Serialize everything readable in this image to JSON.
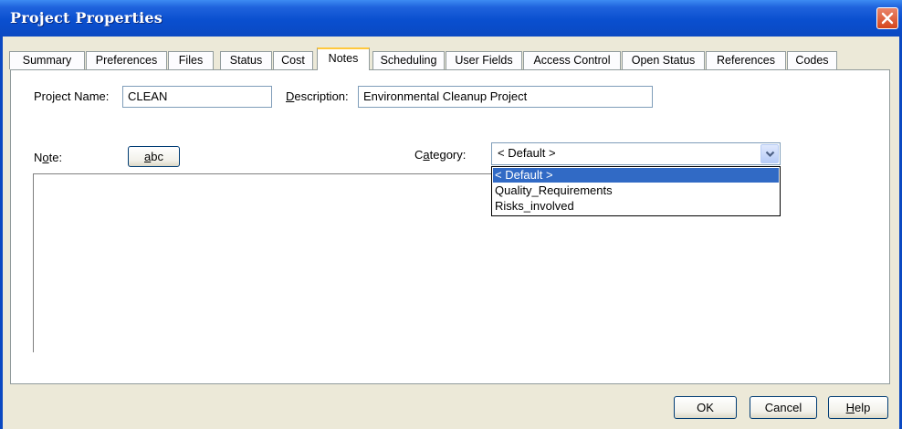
{
  "window": {
    "title": "Project Properties"
  },
  "tabs": [
    {
      "label": "Summary"
    },
    {
      "label": "Preferences"
    },
    {
      "label": "Files"
    },
    {
      "label": "Status"
    },
    {
      "label": "Cost"
    },
    {
      "label": "Notes",
      "active": true
    },
    {
      "label": "Scheduling"
    },
    {
      "label": "User Fields"
    },
    {
      "label": "Access Control"
    },
    {
      "label": "Open Status"
    },
    {
      "label": "References"
    },
    {
      "label": "Codes"
    }
  ],
  "fields": {
    "project_name_label": "Project Name:",
    "project_name_value": "CLEAN",
    "description_label_pre": "",
    "description_label_u": "D",
    "description_label_post": "escription:",
    "description_value": "Environmental Cleanup Project",
    "note_label_pre": "N",
    "note_label_u": "o",
    "note_label_post": "te:",
    "abc_button_u": "a",
    "abc_button_post": "bc",
    "category_label_pre": "C",
    "category_label_u": "a",
    "category_label_post": "tegory:"
  },
  "category": {
    "selected": "< Default >",
    "options": [
      "< Default >",
      "Quality_Requirements",
      "Risks_involved"
    ]
  },
  "buttons": {
    "ok": "OK",
    "cancel": "Cancel",
    "help_u": "H",
    "help_post": "elp"
  },
  "colors": {
    "titlebar": "#0b49c2",
    "active_tab_highlight": "#ffc83c",
    "selection": "#316ac5",
    "dialog_bg": "#ece9d8"
  },
  "icons": {
    "close": "close-icon",
    "dropdown": "chevron-down-icon"
  }
}
